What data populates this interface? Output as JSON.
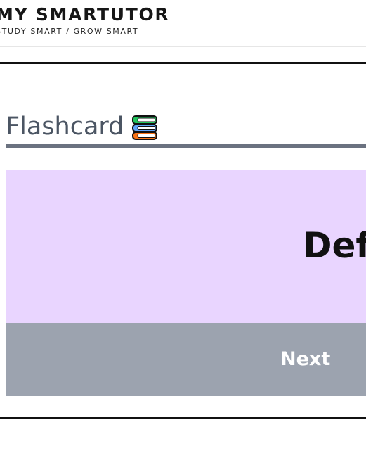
{
  "brand": {
    "title": "MY SMARTUTOR",
    "tagline": "STUDY SMART / GROW SMART"
  },
  "section": {
    "title": "Flashcard",
    "icon": "books-icon"
  },
  "flashcard": {
    "term": "Def",
    "next_label": "Next"
  },
  "colors": {
    "card_background": "#e9d5ff",
    "button_background": "#9ca3af",
    "heading_text": "#4b5563",
    "heading_underline": "#6b7280"
  }
}
